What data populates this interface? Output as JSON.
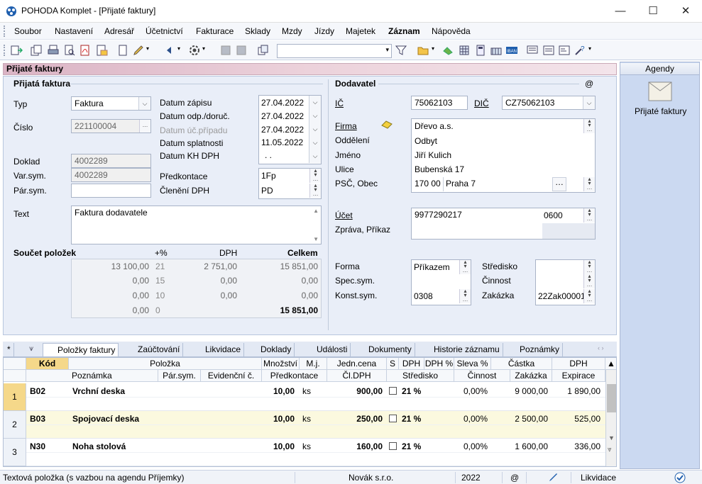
{
  "window": {
    "title": "POHODA Komplet - [Přijaté faktury]",
    "minimize": "—",
    "maximize": "☐",
    "close": "✕"
  },
  "menu": [
    "Soubor",
    "Nastavení",
    "Adresář",
    "Účetnictví",
    "Fakturace",
    "Sklady",
    "Mzdy",
    "Jízdy",
    "Majetek",
    "Záznam",
    "Nápověda"
  ],
  "agenda_title": "Přijaté faktury",
  "invoice": {
    "section": "Přijatá faktura",
    "typ_label": "Typ",
    "typ_value": "Faktura",
    "cislo_label": "Číslo",
    "cislo_value": "221100004",
    "doklad_label": "Doklad",
    "doklad_value": "4002289",
    "varsym_label": "Var.sym.",
    "varsym_value": "4002289",
    "parsym_label": "Pár.sym.",
    "parsym_value": "",
    "text_label": "Text",
    "text_value": "Faktura dodavatele",
    "datum_zapisu_label": "Datum zápisu",
    "datum_zapisu": "27.04.2022",
    "datum_odp_label": "Datum odp./doruč.",
    "datum_odp": "27.04.2022",
    "datum_uc_label": "Datum úč.případu",
    "datum_uc": "27.04.2022",
    "datum_splat_label": "Datum splatnosti",
    "datum_splat": "11.05.2022",
    "datum_kh_label": "Datum KH DPH",
    "datum_kh": ". .",
    "predkontace_label": "Předkontace",
    "predkontace": "1Fp",
    "cleneni_label": "Členění DPH",
    "cleneni": "PD"
  },
  "totals": {
    "title": "Součet položek",
    "h_pct": "+%",
    "h_dph": "DPH",
    "h_celkem": "Celkem",
    "rows": [
      {
        "base": "13 100,00",
        "pct": "21",
        "dph": "2 751,00",
        "total": "15 851,00"
      },
      {
        "base": "0,00",
        "pct": "15",
        "dph": "0,00",
        "total": "0,00"
      },
      {
        "base": "0,00",
        "pct": "10",
        "dph": "0,00",
        "total": "0,00"
      },
      {
        "base": "0,00",
        "pct": "0",
        "dph": "",
        "total": "15 851,00"
      }
    ]
  },
  "supplier": {
    "section": "Dodavatel",
    "at": "@",
    "ic_label": "IČ",
    "ic": "75062103",
    "dic_label": "DIČ",
    "dic": "CZ75062103",
    "firma_label": "Firma",
    "firma": "Dřevo a.s.",
    "oddeleni_label": "Oddělení",
    "oddeleni": "Odbyt",
    "jmeno_label": "Jméno",
    "jmeno": "Jiří Kulich",
    "ulice_label": "Ulice",
    "ulice": "Bubenská 17",
    "psc_label": "PSČ, Obec",
    "psc": "170 00",
    "obec": "Praha 7",
    "ucet_label": "Účet",
    "ucet": "9977290217",
    "banka": "0600",
    "zprava_label": "Zpráva, Příkaz",
    "forma_label": "Forma",
    "forma": "Příkazem",
    "spec_label": "Spec.sym.",
    "konst_label": "Konst.sym.",
    "konst": "0308",
    "stredisko_label": "Středisko",
    "cinnost_label": "Činnost",
    "zakazka_label": "Zakázka",
    "zakazka": "22Zak00001"
  },
  "agendy": {
    "title": "Agendy",
    "item": "Přijaté faktury"
  },
  "tabs": [
    "*",
    "Položky faktury",
    "Zaúčtování",
    "Likvidace",
    "Doklady",
    "Události",
    "Dokumenty",
    "Historie záznamu",
    "Poznámky"
  ],
  "grid": {
    "head1": [
      "Kód",
      "Položka",
      "Množství",
      "M.j.",
      "Jedn.cena",
      "S",
      "DPH",
      "DPH %",
      "Sleva %",
      "Částka",
      "DPH"
    ],
    "head2": [
      "Poznámka",
      "Pár.sym.",
      "Evidenční č.",
      "Předkontace",
      "Čl.DPH",
      "Středisko",
      "Činnost",
      "Zakázka",
      "Expirace"
    ],
    "rows": [
      {
        "n": "1",
        "kod": "B02",
        "nazev": "Vrchní deska",
        "mnozstvi": "10,00",
        "mj": "ks",
        "cena": "900,00",
        "dph": "21 %",
        "sleva": "0,00%",
        "castka": "9 000,00",
        "dphval": "1 890,00"
      },
      {
        "n": "2",
        "kod": "B03",
        "nazev": "Spojovací deska",
        "mnozstvi": "10,00",
        "mj": "ks",
        "cena": "250,00",
        "dph": "21 %",
        "sleva": "0,00%",
        "castka": "2 500,00",
        "dphval": "525,00"
      },
      {
        "n": "3",
        "kod": "N30",
        "nazev": "Noha stolová",
        "mnozstvi": "10,00",
        "mj": "ks",
        "cena": "160,00",
        "dph": "21 %",
        "sleva": "0,00%",
        "castka": "1 600,00",
        "dphval": "336,00"
      }
    ]
  },
  "status": {
    "text": "Textová položka (s vazbou na agendu Příjemky)",
    "company": "Novák s.r.o.",
    "year": "2022",
    "at": "@",
    "likvidace": "Likvidace"
  }
}
